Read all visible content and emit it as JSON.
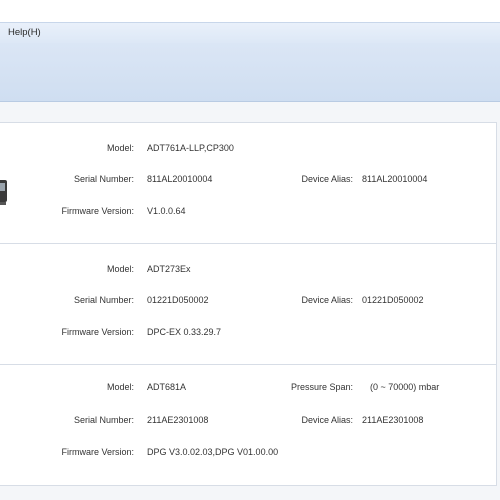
{
  "menubar": {
    "help": "Help(H)"
  },
  "devices": [
    {
      "model_label": "Model:",
      "model": "ADT761A-LLP,CP300",
      "serial_label": "Serial Number:",
      "serial": "811AL20010004",
      "alias_label": "Device Alias:",
      "alias": "811AL20010004",
      "firmware_label": "Firmware Version:",
      "firmware": "V1.0.0.64"
    },
    {
      "model_label": "Model:",
      "model": "ADT273Ex",
      "serial_label": "Serial Number:",
      "serial": "01221D050002",
      "alias_label": "Device Alias:",
      "alias": "01221D050002",
      "firmware_label": "Firmware Version:",
      "firmware": "DPC-EX 0.33.29.7"
    },
    {
      "model_label": "Model:",
      "model": "ADT681A",
      "span_label": "Pressure Span:",
      "span": "(0 ~ 70000) mbar",
      "serial_label": "Serial Number:",
      "serial": "211AE2301008",
      "alias_label": "Device Alias:",
      "alias": "211AE2301008",
      "firmware_label": "Firmware Version:",
      "firmware": "DPG V3.0.02.03,DPG V01.00.00"
    }
  ]
}
